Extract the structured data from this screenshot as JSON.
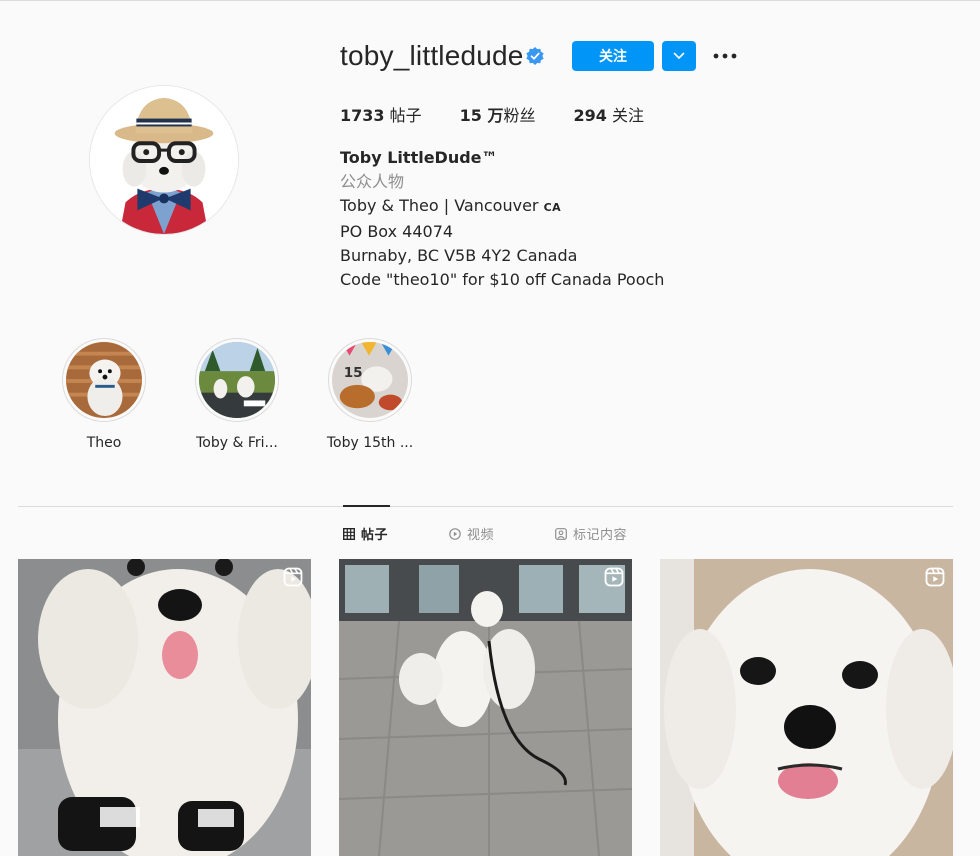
{
  "profile": {
    "username": "toby_littledude",
    "follow_label": "关注",
    "stats": {
      "posts_count": "1733",
      "posts_label": " 帖子",
      "followers_count": "15 万",
      "followers_label": "粉丝",
      "following_count": "294",
      "following_label": " 关注"
    },
    "bio": {
      "name": "Toby LittleDude™",
      "category": "公众人物",
      "line1": "Toby & Theo | Vancouver ",
      "line1_flag": "CA",
      "line2": "PO Box 44074",
      "line3": "Burnaby, BC V5B 4Y2 Canada",
      "line4": "Code \"theo10\" for $10 off Canada Pooch"
    }
  },
  "highlights": [
    {
      "label": "Theo"
    },
    {
      "label": "Toby & Fri..."
    },
    {
      "label": "Toby 15th ..."
    }
  ],
  "tabs": [
    {
      "label": "帖子",
      "icon": "grid-icon",
      "active": true
    },
    {
      "label": "视频",
      "icon": "play-circle-icon",
      "active": false
    },
    {
      "label": "标记内容",
      "icon": "tagged-icon",
      "active": false
    }
  ],
  "posts": [
    {
      "type": "reel",
      "icon": "reels-icon"
    },
    {
      "type": "reel",
      "icon": "reels-icon"
    },
    {
      "type": "reel",
      "icon": "reels-icon"
    }
  ],
  "highlight_sticker_text": "15",
  "colors": {
    "accent": "#0095f6",
    "verified": "#3897f0",
    "muted_text": "#8e8e8e",
    "border": "#dbdbdb"
  }
}
